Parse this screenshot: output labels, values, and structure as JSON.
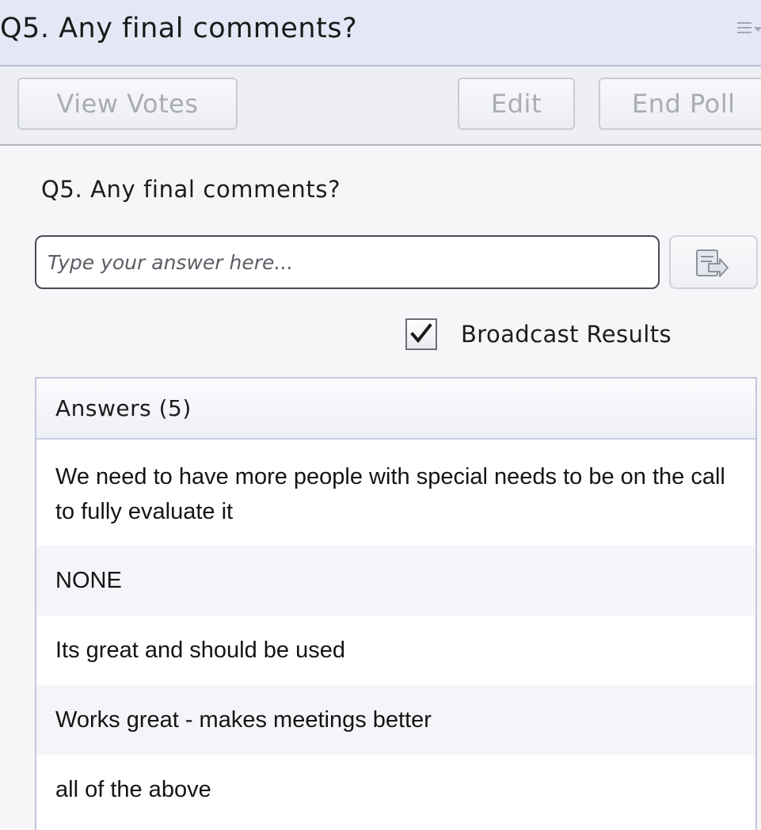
{
  "pod": {
    "title": "Q5. Any final comments?"
  },
  "toolbar": {
    "view_votes_label": "View Votes",
    "edit_label": "Edit",
    "end_poll_label": "End Poll"
  },
  "poll": {
    "question": "Q5. Any final comments?",
    "input_placeholder": "Type your answer here...",
    "input_value": "",
    "broadcast_label": "Broadcast Results",
    "broadcast_checked": true
  },
  "answers": {
    "header": "Answers (5)",
    "items": [
      {
        "text": "We need to have more  people with special needs to be on the call to fully evaluate it"
      },
      {
        "text": "NONE"
      },
      {
        "text": "Its great and should be used"
      },
      {
        "text": "Works great - makes meetings better"
      },
      {
        "text": "all of the above"
      }
    ]
  },
  "colors": {
    "titlebar_bg": "#e4e7f5",
    "disabled_text": "#a9abb5",
    "row_alt_bg": "#f4f5f8"
  },
  "icons": {
    "pod_menu": "pod-menu-icon",
    "send": "send-answer-icon",
    "checkmark": "checkmark-icon"
  }
}
